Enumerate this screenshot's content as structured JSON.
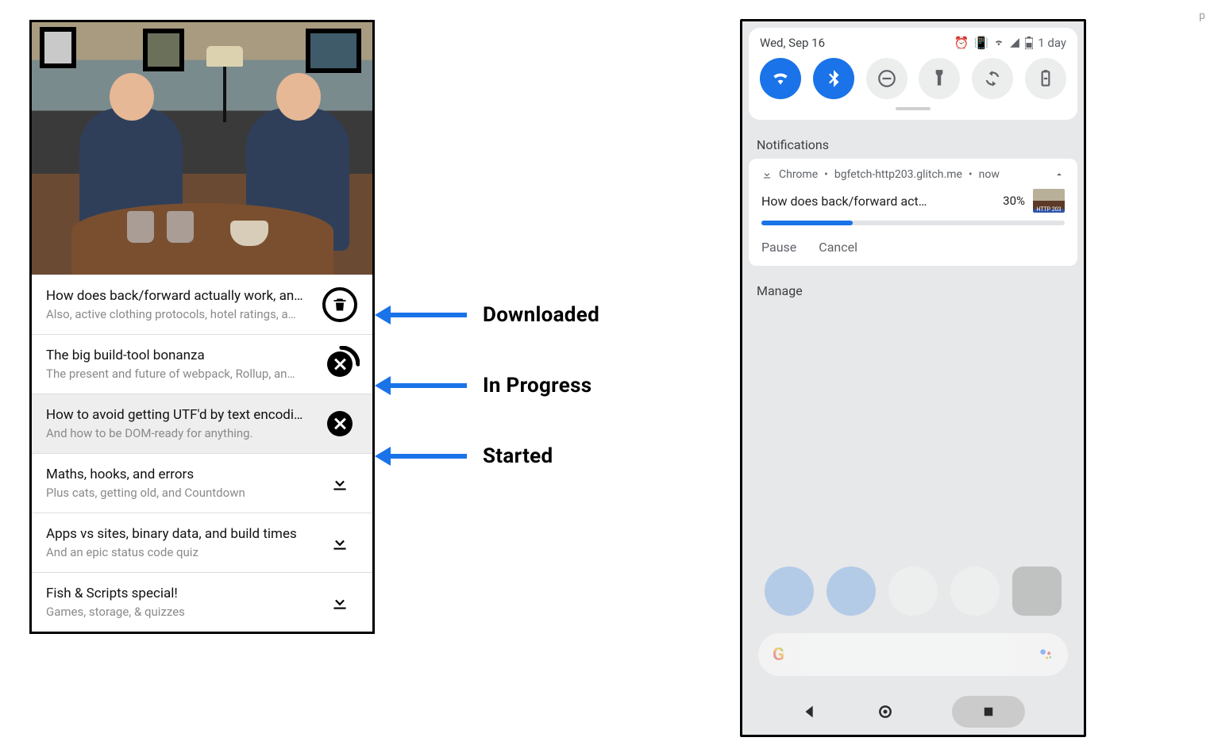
{
  "labels": {
    "downloaded": "Downloaded",
    "in_progress": "In Progress",
    "started": "Started"
  },
  "pwa": {
    "items": [
      {
        "title": "How does back/forward actually work, an…",
        "subtitle": "Also, active clothing protocols, hotel ratings, a…",
        "state": "downloaded",
        "selected": false
      },
      {
        "title": "The big build-tool bonanza",
        "subtitle": "The present and future of webpack, Rollup, an…",
        "state": "in_progress",
        "selected": false
      },
      {
        "title": "How to avoid getting UTF'd by text encodi…",
        "subtitle": "And how to be DOM-ready for anything.",
        "state": "started",
        "selected": true
      },
      {
        "title": "Maths, hooks, and errors",
        "subtitle": "Plus cats, getting old, and Countdown",
        "state": "idle",
        "selected": false
      },
      {
        "title": "Apps vs sites, binary data, and build times",
        "subtitle": "And an epic status code quiz",
        "state": "idle",
        "selected": false
      },
      {
        "title": "Fish & Scripts special!",
        "subtitle": "Games, storage, & quizzes",
        "state": "idle",
        "selected": false
      }
    ]
  },
  "phone": {
    "status": {
      "date": "Wed, Sep 16",
      "battery_text": "1 day"
    },
    "toggles": [
      {
        "name": "wifi",
        "active": true
      },
      {
        "name": "bluetooth",
        "active": true
      },
      {
        "name": "dnd",
        "active": false
      },
      {
        "name": "flashlight",
        "active": false
      },
      {
        "name": "rotate",
        "active": false
      },
      {
        "name": "battery-saver",
        "active": false
      }
    ],
    "section_label": "Notifications",
    "notification": {
      "app": "Chrome",
      "source": "bgfetch-http203.glitch.me",
      "time": "now",
      "title": "How does back/forward act…",
      "percent_text": "30%",
      "percent_value": 30,
      "thumb_caption": "HTTP 203",
      "actions": {
        "pause": "Pause",
        "cancel": "Cancel"
      }
    },
    "manage_label": "Manage"
  },
  "corner": "p"
}
